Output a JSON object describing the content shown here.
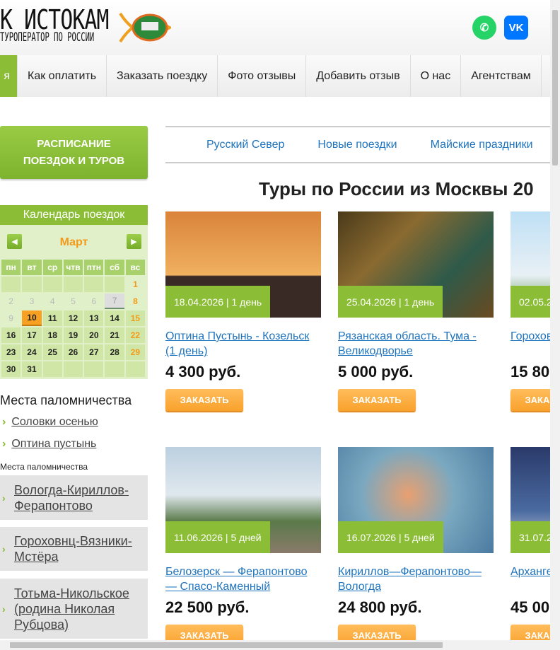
{
  "header": {
    "logo_title": "К ИСТОКАМ",
    "logo_subtitle": "ТУРОПЕРАТОР ПО РОССИИ",
    "social": [
      {
        "icon": "whatsapp-icon",
        "color": "#25d366"
      },
      {
        "icon": "vk-icon",
        "label": "VK",
        "color": "#0077ff"
      }
    ]
  },
  "nav": {
    "items": [
      "я",
      "Как оплатить",
      "Заказать поездку",
      "Фото отзывы",
      "Добавить отзыв",
      "О нас",
      "Агентствам"
    ]
  },
  "sidebar": {
    "schedule_button": [
      "РАСПИСАНИЕ",
      "ПОЕЗДОК И ТУРОВ"
    ],
    "calendar": {
      "title": "Календарь поездок",
      "month": "Март",
      "weekdays": [
        "пн",
        "вт",
        "ср",
        "чтв",
        "птн",
        "сб",
        "вс"
      ],
      "today": 10,
      "days_in_month": 31,
      "first_weekday": 7
    },
    "places_heading": "Места паломничества",
    "places_links": [
      "Соловки осенью",
      "Оптина пустынь"
    ],
    "small_label": "Места паломничества",
    "region_links": [
      "Вологда-Кириллов-Ферапонтово",
      "Гороховнц-Вязники-Мстёра",
      "Тотьма-Никольское (родина Николая Рубцова)"
    ]
  },
  "tabs": [
    "Русский Север",
    "Новые поездки",
    "Майские праздники"
  ],
  "heading": "Туры по России из Москвы 20",
  "order_label": "ЗАКАЗАТЬ",
  "tours": [
    {
      "badge": "18.04.2026 | 1 день",
      "title": "Оптина Пустынь - Козельск (1 день)",
      "price": "4 300 руб."
    },
    {
      "badge": "25.04.2026 | 1 день",
      "title": "Рязанская область. Тума - Великодворье",
      "price": "5 000 руб."
    },
    {
      "badge": "02.05.2",
      "title": "Горохов",
      "price": "15 80"
    },
    {
      "badge": "11.06.2026 | 5 дней",
      "title": "Белозерск — Ферапонтово — Спасо-Каменный",
      "price": "22 500 руб."
    },
    {
      "badge": "16.07.2026 | 5 дней",
      "title": "Кириллов—Ферапонтово—Вологда",
      "price": "24 800 руб."
    },
    {
      "badge": "31.07.2",
      "title": "Архангe",
      "price": "45 00"
    }
  ]
}
